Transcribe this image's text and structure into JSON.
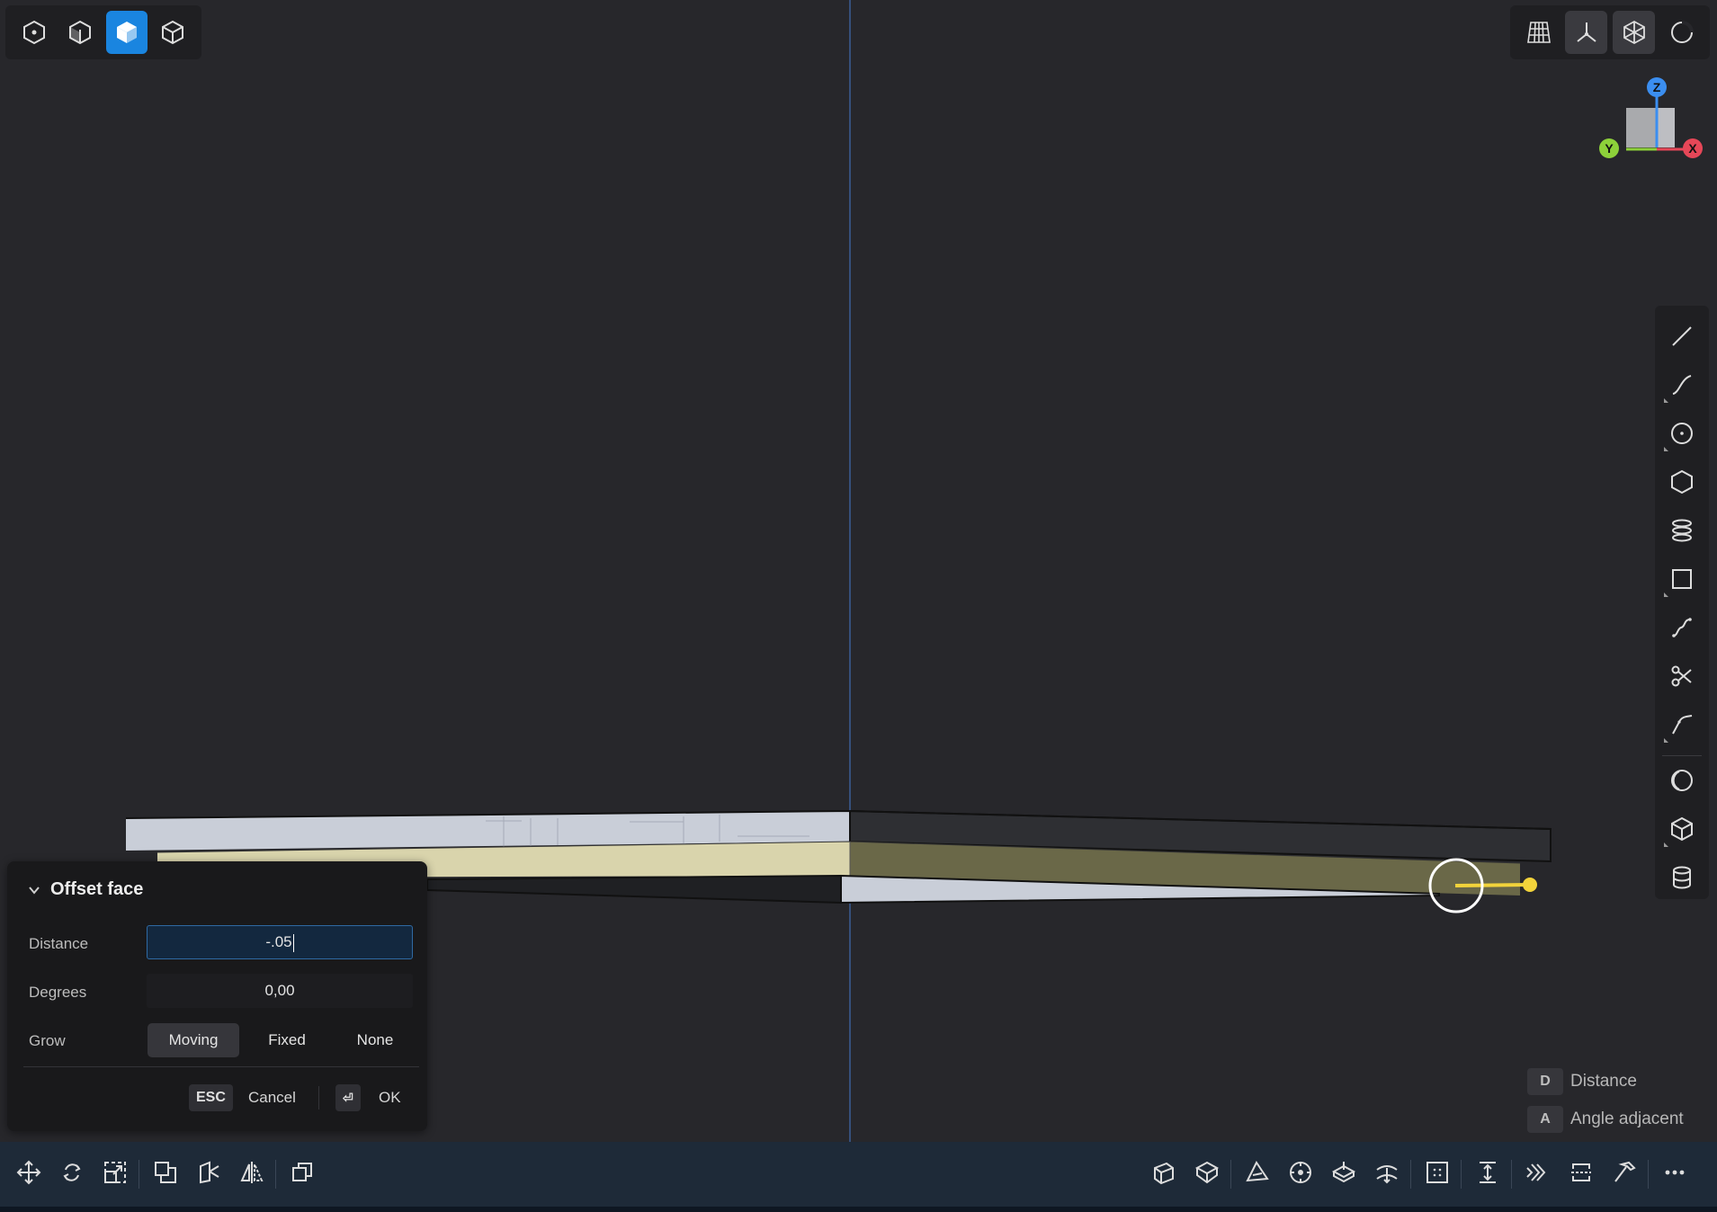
{
  "view_modes": {
    "items": [
      {
        "icon": "point-view-icon"
      },
      {
        "icon": "hidden-line-view-icon"
      },
      {
        "icon": "shaded-view-icon",
        "active": true
      },
      {
        "icon": "wireframe-view-icon"
      }
    ]
  },
  "top_right_tools": [
    {
      "icon": "grid-icon"
    },
    {
      "icon": "axes-icon"
    },
    {
      "icon": "xray-icon"
    },
    {
      "icon": "overlay-icon"
    }
  ],
  "view_cube": {
    "z_label": "Z",
    "y_label": "Y",
    "x_label": "X"
  },
  "offset_panel": {
    "title": "Offset face",
    "distance_label": "Distance",
    "distance_value": "-.05",
    "degrees_label": "Degrees",
    "degrees_value": "0,00",
    "grow_label": "Grow",
    "grow_options": [
      "Moving",
      "Fixed",
      "None"
    ],
    "grow_selected": "Moving",
    "cancel_key": "ESC",
    "cancel_label": "Cancel",
    "ok_key": "⏎",
    "ok_label": "OK"
  },
  "shortcut_hints": [
    {
      "key": "D",
      "label": "Distance"
    },
    {
      "key": "A",
      "label": "Angle adjacent"
    }
  ],
  "colors": {
    "background": "#27272b",
    "accent": "#1a85e0",
    "bottom_bar": "#1e2a38",
    "gizmo": "#f2d33b"
  }
}
